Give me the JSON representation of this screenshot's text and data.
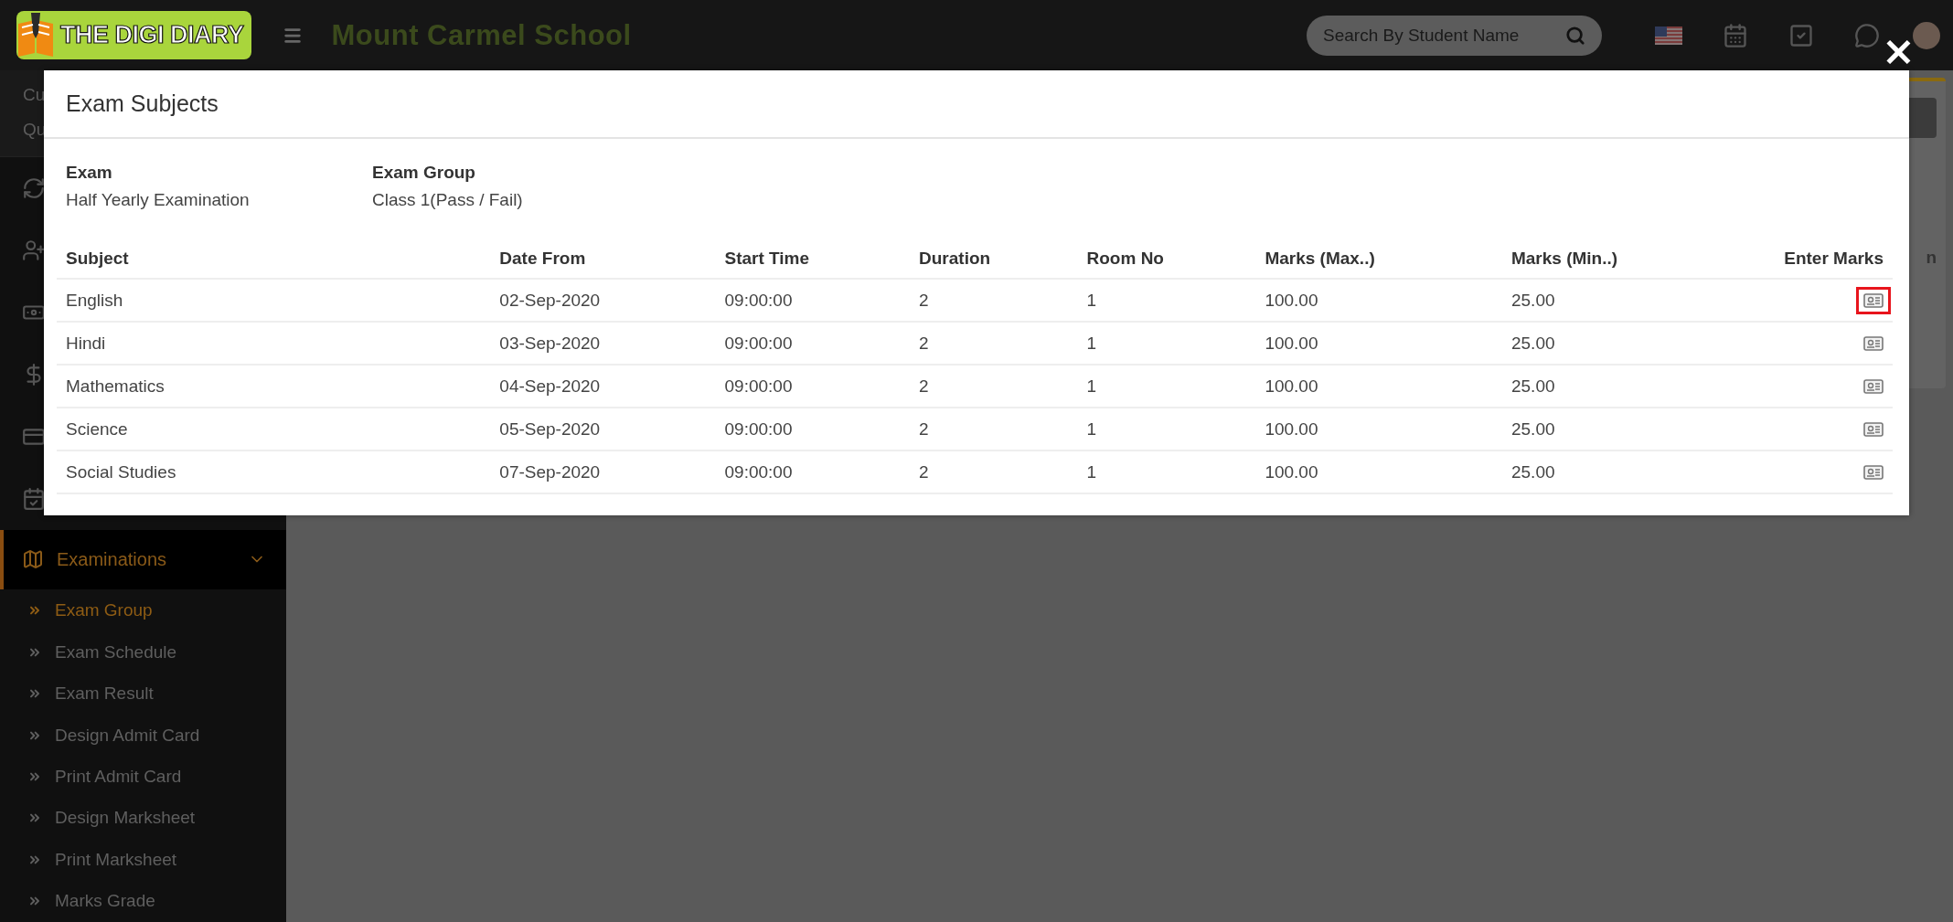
{
  "header": {
    "logo_text": "THE DIGI DIARY",
    "school_name": "Mount Carmel School",
    "search": {
      "placeholder": "Search By Student Name"
    }
  },
  "sidebar": {
    "cut_texts": [
      "Cu",
      "Qu"
    ],
    "section": {
      "label": "Examinations",
      "expanded": true,
      "children": [
        {
          "label": "Exam Group",
          "selected": true
        },
        {
          "label": "Exam Schedule",
          "selected": false
        },
        {
          "label": "Exam Result",
          "selected": false
        },
        {
          "label": "Design Admit Card",
          "selected": false
        },
        {
          "label": "Print Admit Card",
          "selected": false
        },
        {
          "label": "Design Marksheet",
          "selected": false
        },
        {
          "label": "Print Marksheet",
          "selected": false
        },
        {
          "label": "Marks Grade",
          "selected": false
        }
      ]
    }
  },
  "background_card": {
    "cut_text": "n"
  },
  "modal": {
    "title": "Exam Subjects",
    "close": "×",
    "fields": [
      {
        "label": "Exam",
        "value": "Half Yearly Examination"
      },
      {
        "label": "Exam Group",
        "value": "Class 1(Pass / Fail)"
      }
    ],
    "table": {
      "columns": [
        "Subject",
        "Date From",
        "Start Time",
        "Duration",
        "Room No",
        "Marks (Max..)",
        "Marks (Min..)",
        "Enter Marks"
      ],
      "rows": [
        {
          "cells": [
            "English",
            "02-Sep-2020",
            "09:00:00",
            "2",
            "1",
            "100.00",
            "25.00"
          ],
          "highlighted": true
        },
        {
          "cells": [
            "Hindi",
            "03-Sep-2020",
            "09:00:00",
            "2",
            "1",
            "100.00",
            "25.00"
          ],
          "highlighted": false
        },
        {
          "cells": [
            "Mathematics",
            "04-Sep-2020",
            "09:00:00",
            "2",
            "1",
            "100.00",
            "25.00"
          ],
          "highlighted": false
        },
        {
          "cells": [
            "Science",
            "05-Sep-2020",
            "09:00:00",
            "2",
            "1",
            "100.00",
            "25.00"
          ],
          "highlighted": false
        },
        {
          "cells": [
            "Social Studies",
            "07-Sep-2020",
            "09:00:00",
            "2",
            "1",
            "100.00",
            "25.00"
          ],
          "highlighted": false
        }
      ]
    }
  }
}
